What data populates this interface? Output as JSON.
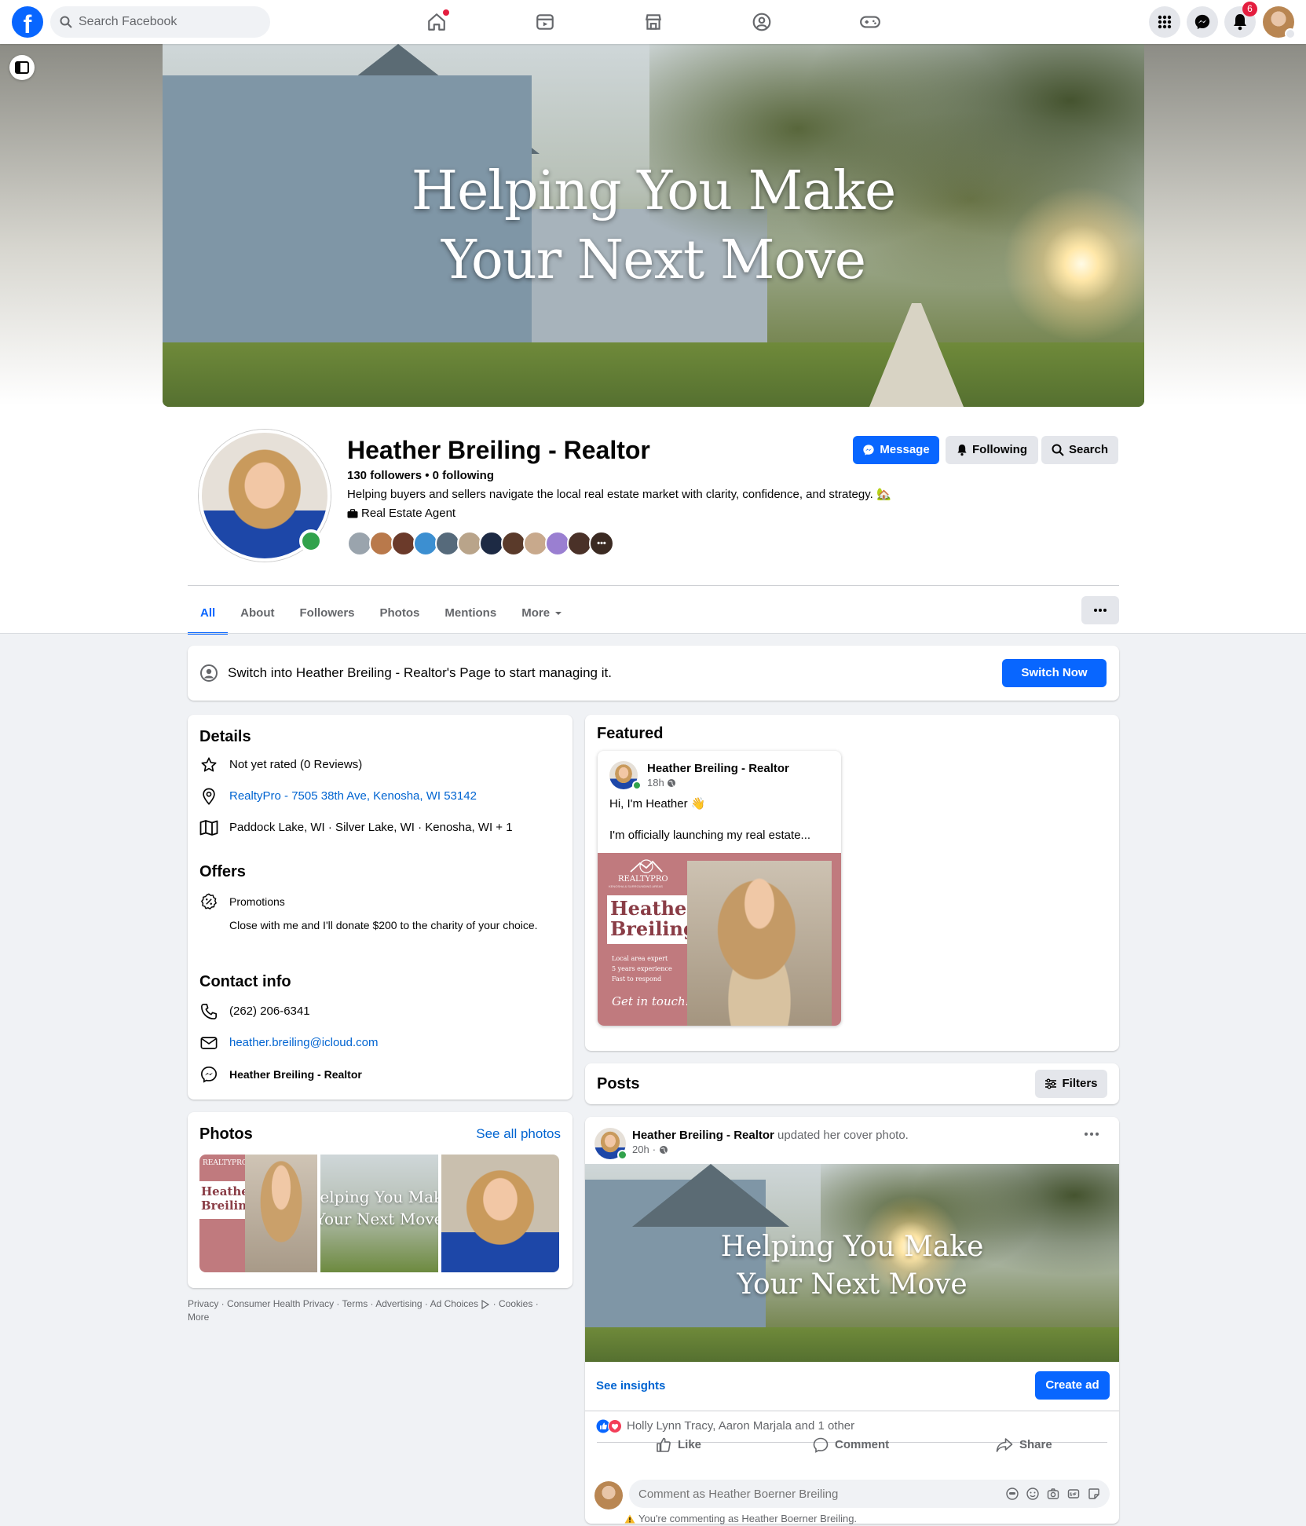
{
  "topbar": {
    "logo": "f",
    "search_placeholder": "Search Facebook",
    "nav_icons": [
      "home-icon",
      "video-icon",
      "marketplace-icon",
      "groups-icon",
      "gaming-icon"
    ],
    "notifications_count": "6"
  },
  "cover": {
    "title_line1": "Helping You Make",
    "title_line2": "Your Next Move"
  },
  "profile": {
    "name": "Heather Breiling - Realtor",
    "followers": "130 followers",
    "separator": "•",
    "following": "0 following",
    "bio": "Helping buyers and sellers navigate the local real estate market with clarity, confidence, and strategy. 🏡",
    "category": "Real Estate Agent",
    "friend_more": "•••"
  },
  "actions": {
    "message": "Message",
    "following": "Following",
    "search": "Search"
  },
  "tabs": [
    "All",
    "About",
    "Followers",
    "Photos",
    "Mentions",
    "More"
  ],
  "switch_banner": {
    "text": "Switch into Heather Breiling - Realtor's Page to start managing it.",
    "button": "Switch Now"
  },
  "details": {
    "heading": "Details",
    "rating": "Not yet rated (0 Reviews)",
    "address": "RealtyPro - 7505 38th Ave, Kenosha, WI 53142",
    "areas": "Paddock Lake, WI · Silver Lake, WI · Kenosha, WI + 1",
    "offers_heading": "Offers",
    "promotions": "Promotions",
    "offer_text": "Close with me and I'll donate $200 to the charity of your choice.",
    "contact_heading": "Contact info",
    "phone": "(262) 206-6341",
    "email": "heather.breiling@icloud.com",
    "messenger": "Heather Breiling - Realtor"
  },
  "photos": {
    "heading": "Photos",
    "see_all": "See all photos",
    "thumb1_brand": "REALTYPRO",
    "thumb1_name1": "Heather",
    "thumb1_name2": "Breiling",
    "thumb2_line1": "Helping You Make",
    "thumb2_line2": "Your Next Move"
  },
  "footer": {
    "links": [
      "Privacy",
      "Consumer Health Privacy",
      "Terms",
      "Advertising",
      "Ad Choices",
      "Cookies",
      "More"
    ]
  },
  "featured": {
    "heading": "Featured",
    "author": "Heather Breiling - Realtor",
    "time": "18h",
    "line1": "Hi, I'm Heather 👋",
    "line2": "I'm officially launching my real estate...",
    "brand": "REALTYPRO",
    "brand_sub": "KENOSHA & SURROUNDING AREAS",
    "flyer_name1": "Heather",
    "flyer_name2": "Breiling",
    "flyer_bullets": [
      "Local area expert",
      "5 years experience",
      "Fast to respond"
    ],
    "flyer_cta": "Get in touch!"
  },
  "posts": {
    "heading": "Posts",
    "filters": "Filters"
  },
  "post": {
    "author": "Heather Breiling - Realtor",
    "action": "updated her cover photo.",
    "time": "20h",
    "photo_line1": "Helping You Make",
    "photo_line2": "Your Next Move",
    "see_insights": "See insights",
    "create_ad": "Create ad",
    "reactions": "Holly Lynn Tracy, Aaron Marjala and 1 other",
    "like": "Like",
    "comment": "Comment",
    "share": "Share",
    "comment_placeholder": "Comment as Heather Boerner Breiling",
    "commenting_note": "You're commenting as Heather Boerner Breiling."
  },
  "colors": {
    "brand_blue": "#0866ff",
    "link_blue": "#0064d1",
    "online_green": "#31a24c",
    "badge_red": "#e41e3f",
    "flyer_rose": "#c07a7e"
  }
}
